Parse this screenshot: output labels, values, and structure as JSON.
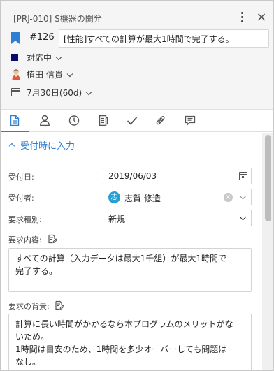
{
  "header": {
    "project_title": "[PRJ-010] S機器の開発",
    "issue_number": "#126",
    "issue_title": "[性能]すべての計算が最大1時間で完了する。",
    "status": "対応中",
    "assignee": "植田 信貴",
    "due": "7月30日(60d)",
    "status_color": "#0a0a6e",
    "accent_color": "#2f7fd1"
  },
  "tabs": [
    {
      "icon": "document-icon",
      "active": true
    },
    {
      "icon": "person-icon",
      "active": false
    },
    {
      "icon": "clock-icon",
      "active": false
    },
    {
      "icon": "notes-icon",
      "active": false
    },
    {
      "icon": "check-icon",
      "active": false
    },
    {
      "icon": "paperclip-icon",
      "active": false
    },
    {
      "icon": "comment-icon",
      "active": false
    }
  ],
  "section": {
    "title": "受付時に入力"
  },
  "form": {
    "received_date_label": "受付日:",
    "received_date_value": "2019/06/03",
    "receiver_label": "受付者:",
    "receiver_initial": "志",
    "receiver_value": "志賀 修造",
    "request_type_label": "要求種別:",
    "request_type_value": "新規",
    "request_content_label": "要求内容:",
    "request_content_line1": "すべての計算（入力データは最大1千組）が最大1時間で",
    "request_content_line2": "完了する。",
    "request_background_label": "要求の背景:",
    "request_background_line1": "計算に長い時間がかかるなら本プログラムのメリットがな",
    "request_background_line2": "いため。",
    "request_background_line3": "1時間は目安のため、1時間を多少オーバーしても問題は",
    "request_background_line4": "なし。"
  }
}
